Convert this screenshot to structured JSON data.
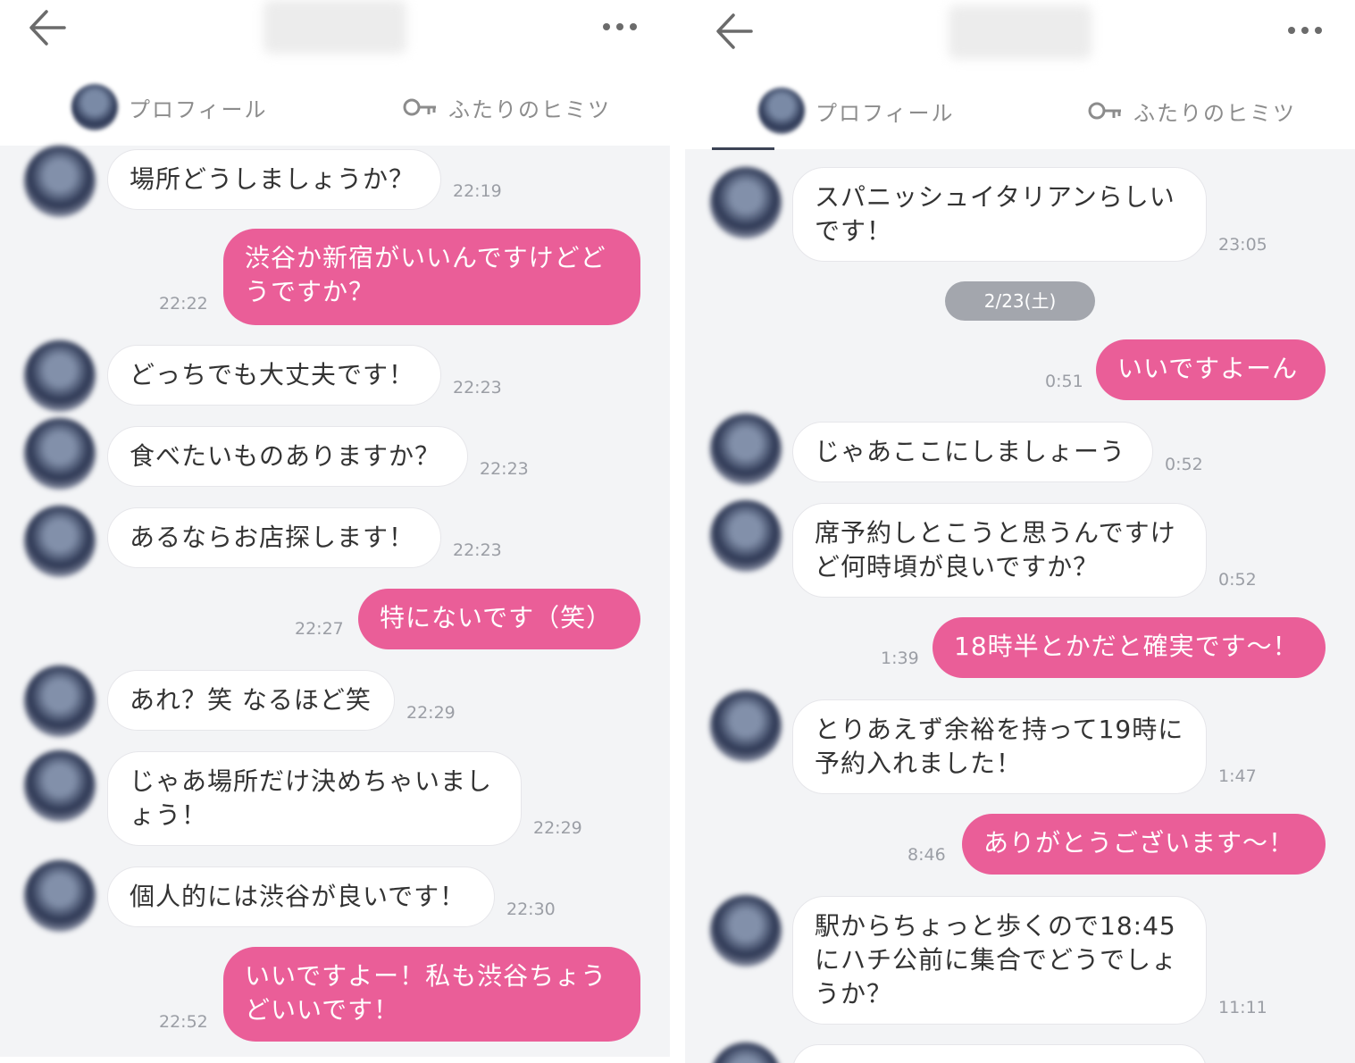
{
  "panels": [
    {
      "tabs": {
        "profile": "プロフィール",
        "secret": "ふたりのヒミツ"
      },
      "messages": [
        {
          "from": "them",
          "text": "場所どうしましょうか？",
          "time": "22:19"
        },
        {
          "from": "me",
          "text": "渋谷か新宿がいいんですけどどうですか？",
          "time": "22:22"
        },
        {
          "from": "them",
          "text": "どっちでも大丈夫です！",
          "time": "22:23"
        },
        {
          "from": "them",
          "text": "食べたいものありますか？",
          "time": "22:23"
        },
        {
          "from": "them",
          "text": "あるならお店探します！",
          "time": "22:23"
        },
        {
          "from": "me",
          "text": "特にないです（笑）",
          "time": "22:27"
        },
        {
          "from": "them",
          "text": "あれ？笑 なるほど笑",
          "time": "22:29"
        },
        {
          "from": "them",
          "text": "じゃあ場所だけ決めちゃいましょう！",
          "time": "22:29"
        },
        {
          "from": "them",
          "text": "個人的には渋谷が良いです！",
          "time": "22:30"
        },
        {
          "from": "me",
          "text": "いいですよー！私も渋谷ちょうどいいです！",
          "time": "22:52"
        }
      ]
    },
    {
      "tabs": {
        "profile": "プロフィール",
        "secret": "ふたりのヒミツ"
      },
      "date_separator": "2/23(土)",
      "messages": [
        {
          "from": "them",
          "text": "スパニッシュイタリアンらしいです！",
          "time": "23:05"
        },
        {
          "from": "me",
          "text": "いいですよーん",
          "time": "0:51"
        },
        {
          "from": "them",
          "text": "じゃあここにしましょーう",
          "time": "0:52"
        },
        {
          "from": "them",
          "text": "席予約しとこうと思うんですけど何時頃が良いですか？",
          "time": "0:52"
        },
        {
          "from": "me",
          "text": "18時半とかだと確実です～！",
          "time": "1:39"
        },
        {
          "from": "them",
          "text": "とりあえず余裕を持って19時に予約入れました！",
          "time": "1:47"
        },
        {
          "from": "me",
          "text": "ありがとうございます～！",
          "time": "8:46"
        },
        {
          "from": "them",
          "text": "駅からちょっと歩くので18:45にハチ公前に集合でどうでしょうか？",
          "time": "11:11"
        }
      ]
    }
  ],
  "colors": {
    "outgoing_bubble": "#ea5e98",
    "incoming_bubble": "#ffffff",
    "chat_background": "#f3f4f6",
    "date_pill": "#a3a6ad"
  },
  "icons": [
    "back-arrow-icon",
    "more-dots-icon",
    "key-icon"
  ]
}
